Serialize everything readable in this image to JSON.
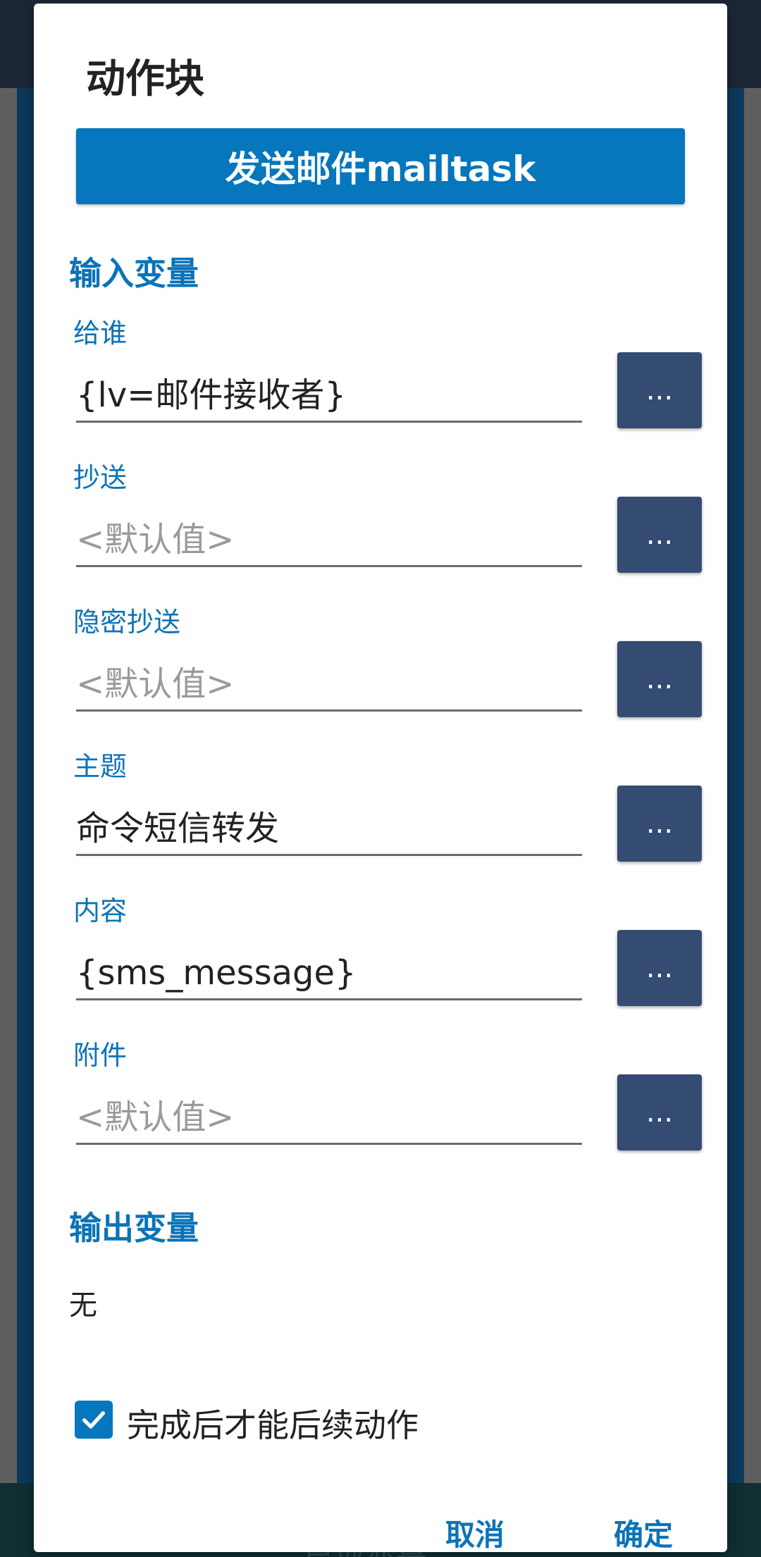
{
  "background": {
    "bottom_text": "局部变量"
  },
  "dialog": {
    "title": "动作块",
    "action_name": "发送邮件mailtask",
    "input_section": "输入变量",
    "fields": [
      {
        "label": "给谁",
        "value": "{lv=邮件接收者}",
        "placeholder": false
      },
      {
        "label": "抄送",
        "value": "<默认值>",
        "placeholder": true
      },
      {
        "label": "隐密抄送",
        "value": "<默认值>",
        "placeholder": true
      },
      {
        "label": "主题",
        "value": "命令短信转发",
        "placeholder": false
      },
      {
        "label": "内容",
        "value": "{sms_message}",
        "placeholder": false
      },
      {
        "label": "附件",
        "value": "<默认值>",
        "placeholder": true
      }
    ],
    "dots_label": "...",
    "output_section": "输出变量",
    "output_value": "无",
    "checkbox": {
      "label": "完成后才能后续动作",
      "checked": true
    },
    "cancel_label": "取消",
    "ok_label": "确定"
  },
  "colors": {
    "accent": "#0676bd",
    "dots_button": "#344b72",
    "section_text": "#0b73b8"
  }
}
